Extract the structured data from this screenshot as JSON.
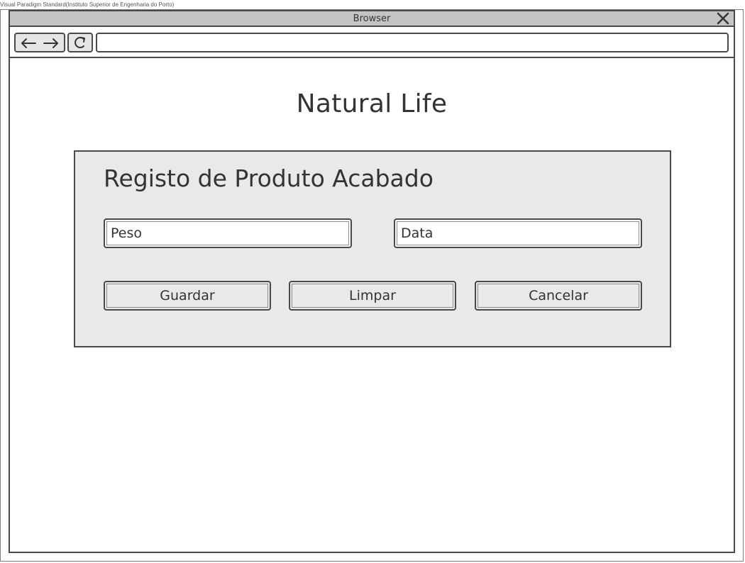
{
  "watermark": "Visual Paradigm Standard(Instituto Superior de Engenharia do Porto)",
  "browser": {
    "title": "Browser",
    "address": ""
  },
  "icons": {
    "close": "close-icon",
    "back": "arrow-left-icon",
    "forward": "arrow-right-icon",
    "refresh": "refresh-icon"
  },
  "app": {
    "title": "Natural Life"
  },
  "form": {
    "heading": "Registo de Produto Acabado",
    "fields": {
      "peso_placeholder": "Peso",
      "data_placeholder": "Data"
    },
    "buttons": {
      "save": "Guardar",
      "clear": "Limpar",
      "cancel": "Cancelar"
    }
  },
  "colors": {
    "panel": "#e9e9e9",
    "titlebar": "#c4c4c4",
    "border": "#4a4a4a",
    "text": "#333333"
  }
}
